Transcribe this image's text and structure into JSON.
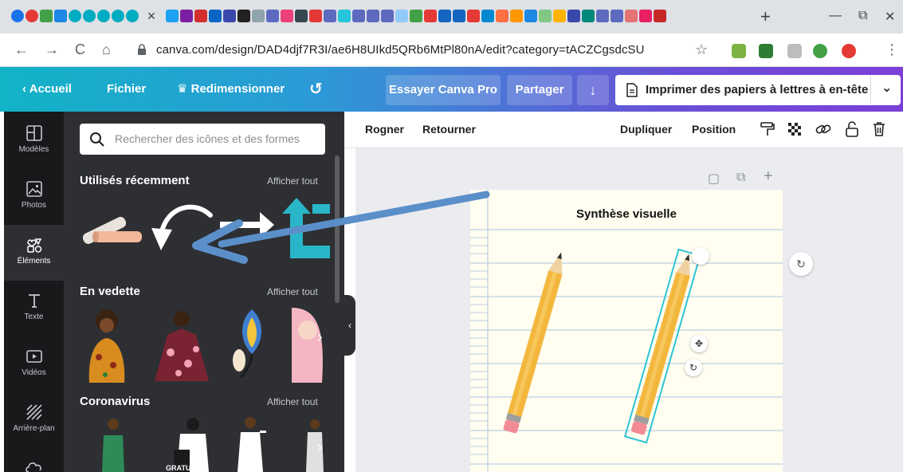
{
  "browser": {
    "url": "canva.com/design/DAD4djf7R3I/ae6H8UIkd5QRb6MtPl80nA/edit?category=tACZCgsdcSU",
    "tab_close": "×",
    "new_tab": "+",
    "window_min": "—",
    "window_restore": "⧉",
    "window_close": "✕",
    "nav_back": "←",
    "nav_forward": "→",
    "nav_reload": "C",
    "nav_home": "⌂",
    "bookmark": "☆",
    "menu": "⋮"
  },
  "header": {
    "home": "Accueil",
    "file": "Fichier",
    "resize": "Redimensionner",
    "undo": "↺",
    "try_pro": "Essayer Canva Pro",
    "share": "Partager",
    "download": "↓",
    "print": "Imprimer des papiers à lettres à en-tête",
    "print_chevron": "⌄"
  },
  "rail": {
    "items": [
      {
        "label": "Modèles",
        "icon": "templates-icon"
      },
      {
        "label": "Photos",
        "icon": "photos-icon"
      },
      {
        "label": "Éléments",
        "icon": "elements-icon",
        "active": true
      },
      {
        "label": "Texte",
        "icon": "text-icon"
      },
      {
        "label": "Vidéos",
        "icon": "videos-icon"
      },
      {
        "label": "Arrière-plan",
        "icon": "background-icon"
      }
    ]
  },
  "panel": {
    "search_placeholder": "Rechercher des icônes et des formes",
    "sections": [
      {
        "title": "Utilisés récemment",
        "link": "Afficher tout"
      },
      {
        "title": "En vedette",
        "link": "Afficher tout"
      },
      {
        "title": "Coronavirus",
        "link": "Afficher tout"
      }
    ],
    "badge": "GRATUIT",
    "chevron": "›",
    "collapse": "‹"
  },
  "editor": {
    "toolbar": {
      "crop": "Rogner",
      "flip": "Retourner",
      "duplicate": "Dupliquer",
      "position": "Position"
    },
    "page_title": "Synthèse visuelle",
    "page_controls": [
      "▢",
      "⧉",
      "+"
    ]
  },
  "colors": {
    "header_start": "#12b3c7",
    "header_end": "#7b3fd8",
    "rail_bg": "#18191b",
    "panel_bg": "#2d2f33",
    "editor_bg": "#ebecf0",
    "annotation_arrow": "#5b8fc9",
    "pencil": "#f4b73d"
  }
}
